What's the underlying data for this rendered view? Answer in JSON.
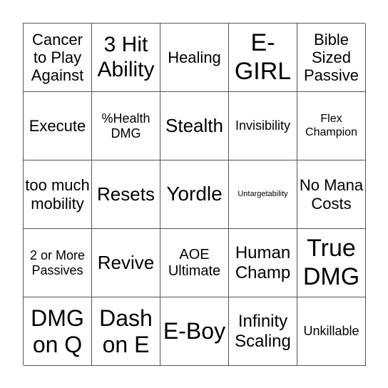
{
  "cells": [
    {
      "text": "Cancer to Play Against",
      "size": 22
    },
    {
      "text": "3 Hit Ability",
      "size": 30
    },
    {
      "text": "Healing",
      "size": 22
    },
    {
      "text": "E-GIRL",
      "size": 34
    },
    {
      "text": "Bible Sized Passive",
      "size": 22
    },
    {
      "text": "Execute",
      "size": 22
    },
    {
      "text": "%Health DMG",
      "size": 18
    },
    {
      "text": "Stealth",
      "size": 26
    },
    {
      "text": "Invisibility",
      "size": 18
    },
    {
      "text": "Flex Champion",
      "size": 16
    },
    {
      "text": "too much mobility",
      "size": 22
    },
    {
      "text": "Resets",
      "size": 26
    },
    {
      "text": "Yordle",
      "size": 28
    },
    {
      "text": "Untargetability",
      "size": 11
    },
    {
      "text": "No Mana Costs",
      "size": 22
    },
    {
      "text": "2 or More Passives",
      "size": 18
    },
    {
      "text": "Revive",
      "size": 26
    },
    {
      "text": "AOE Ultimate",
      "size": 20
    },
    {
      "text": "Human Champ",
      "size": 24
    },
    {
      "text": "True DMG",
      "size": 34
    },
    {
      "text": "DMG on Q",
      "size": 32
    },
    {
      "text": "Dash on E",
      "size": 32
    },
    {
      "text": "E-Boy",
      "size": 32
    },
    {
      "text": "Infinity Scaling",
      "size": 24
    },
    {
      "text": "Unkillable",
      "size": 18
    }
  ]
}
